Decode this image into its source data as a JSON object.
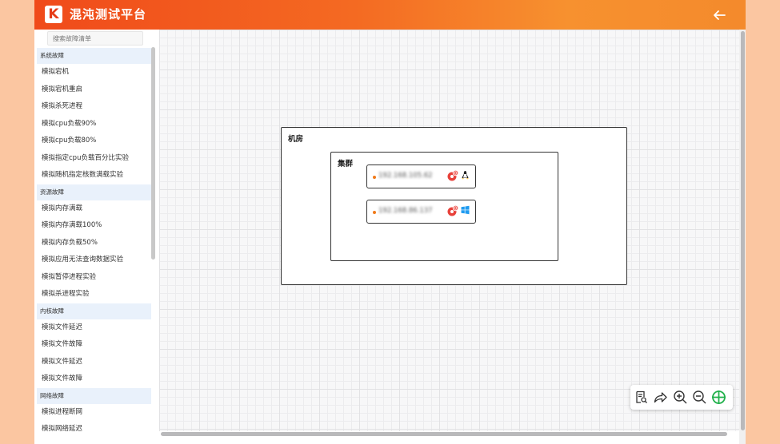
{
  "header": {
    "logo_letter": "K",
    "title": "混沌测试平台"
  },
  "sidebar": {
    "search_placeholder": "搜索故障清单",
    "categories": [
      {
        "name": "系统故障",
        "items": [
          "模拟宕机",
          "模拟宕机重启",
          "模拟杀死进程",
          "模拟cpu负载90%",
          "模拟cpu负载80%",
          "模拟指定cpu负载百分比实验",
          "模拟随机指定核数满载实验"
        ]
      },
      {
        "name": "资源故障",
        "items": [
          "模拟内存满载",
          "模拟内存满载100%",
          "模拟内存负载50%",
          "模拟应用无法查询数据实验",
          "模拟暂停进程实验",
          "模拟杀进程实验"
        ]
      },
      {
        "name": "内核故障",
        "items": [
          "模拟文件延迟",
          "模拟文件故障",
          "模拟文件延迟",
          "模拟文件故障"
        ]
      },
      {
        "name": "网络故障",
        "items": [
          "模拟进程断网",
          "模拟网络延迟"
        ]
      }
    ]
  },
  "topology": {
    "room_label": "机房",
    "cluster_label": "集群",
    "hosts": [
      {
        "ip": "192.168.105.62",
        "fault_count": "0",
        "os": "linux-icon"
      },
      {
        "ip": "192.168.86.137",
        "fault_count": "0",
        "os": "windows-icon"
      }
    ]
  },
  "colors": {
    "accent": "#f46a22",
    "fault_badge": "#e8413a",
    "zoom_fit": "#22b14c"
  },
  "toolbar_icons": [
    "search-document-icon",
    "share-forward-icon",
    "zoom-in-icon",
    "zoom-out-icon",
    "fit-center-icon"
  ]
}
